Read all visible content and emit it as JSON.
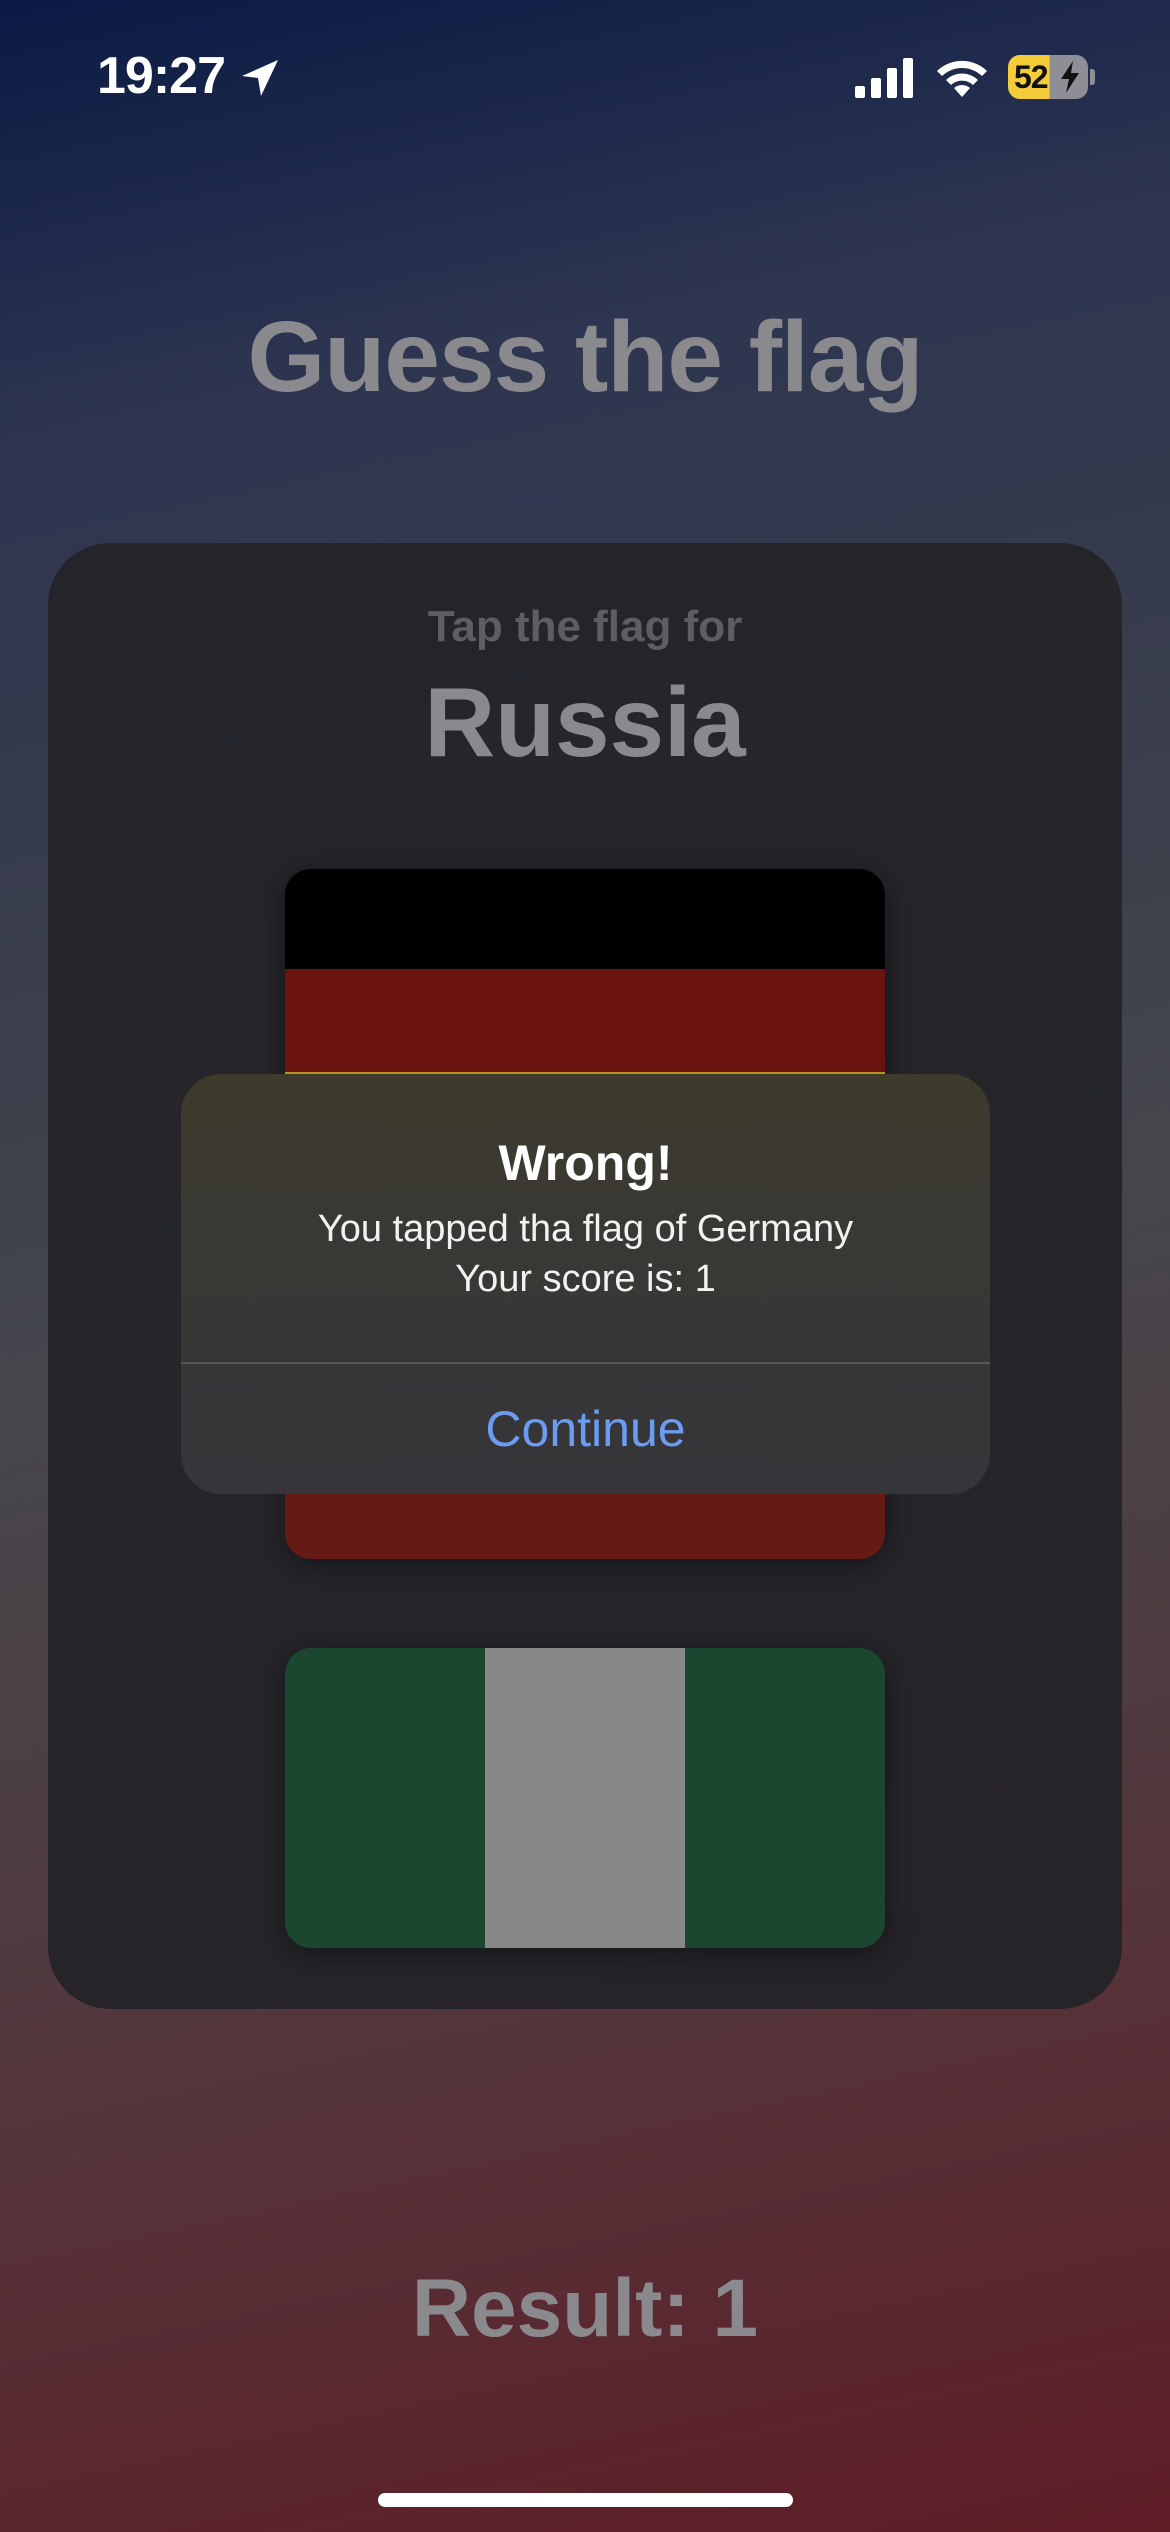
{
  "status_bar": {
    "time": "19:27",
    "battery_level": "52",
    "icons": [
      "location-arrow-icon",
      "cellular-signal-icon",
      "wifi-icon",
      "battery-charging-icon"
    ]
  },
  "app": {
    "title": "Guess the flag",
    "prompt": "Tap the flag for",
    "country": "Russia",
    "result": "Result: 1"
  },
  "flags": [
    {
      "name": "flag-germany",
      "stripes": [
        "#000000",
        "#6a130f",
        "#c9a227",
        "#6a130f",
        "#6a130f"
      ]
    },
    {
      "name": "flag-nigeria",
      "stripes": [
        "#1b4730",
        "#888888",
        "#1b4730"
      ]
    }
  ],
  "alert": {
    "title": "Wrong!",
    "message_line1": "You tapped tha flag of Germany",
    "message_line2": "Your score is: 1",
    "button": "Continue"
  },
  "colors": {
    "accent": "#6c9cf0",
    "title_gray": "#8a8a8e"
  }
}
